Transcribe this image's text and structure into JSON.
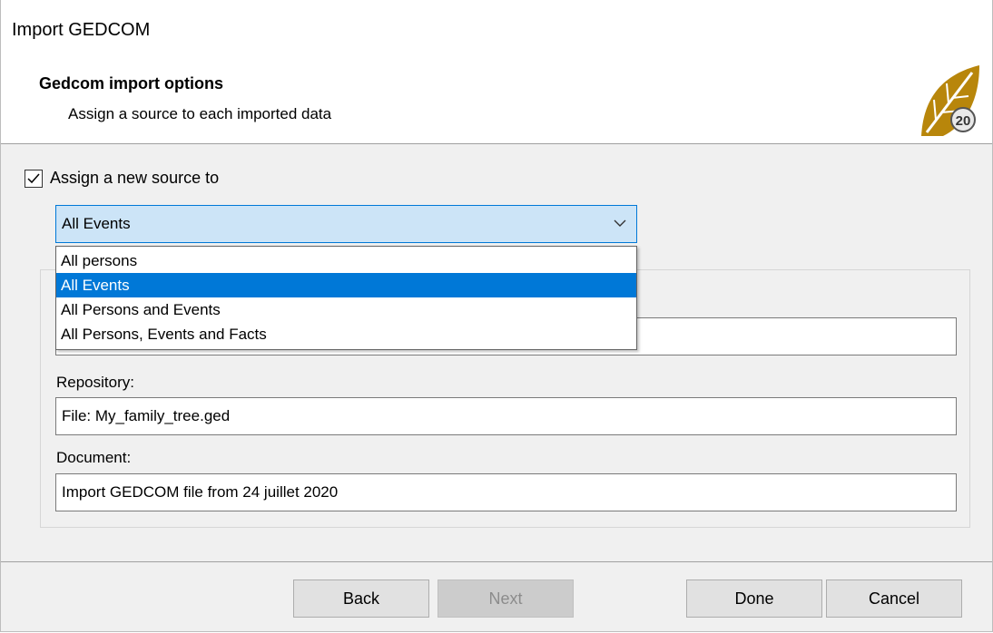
{
  "window": {
    "title": "Import GEDCOM"
  },
  "header": {
    "title": "Gedcom import options",
    "subtitle": "Assign a source to each imported data",
    "logo_text": "20"
  },
  "options": {
    "assign_checkbox_label": "Assign a new source to",
    "assign_checked": true,
    "scope_selected": "All Events",
    "scope_options": [
      "All persons",
      "All Events",
      "All Persons and Events",
      "All Persons, Events and Facts"
    ],
    "highlighted_index": 1
  },
  "fields": {
    "repository_label": "Repository:",
    "repository_value": "File: My_family_tree.ged",
    "document_label": "Document:",
    "document_value": "Import GEDCOM file from 24 juillet 2020"
  },
  "buttons": {
    "back": "Back",
    "next": "Next",
    "done": "Done",
    "cancel": "Cancel"
  },
  "colors": {
    "accent": "#0078d7",
    "combo_bg": "#cce4f7",
    "logo_gold": "#b8860b"
  }
}
